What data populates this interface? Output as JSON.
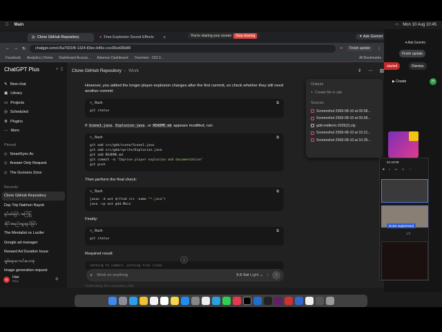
{
  "menubar": {
    "app": "Main",
    "time": "Mon 10 Aug 10:45"
  },
  "share": {
    "text": "You're sharing your screen",
    "stop": "Stop sharing"
  },
  "browser": {
    "tabs": [
      {
        "label": "Clone GitHub Repository"
      },
      {
        "label": "Free Explosion Sound Effects"
      }
    ],
    "ask_gemini": "Ask Gemini",
    "url": "chatgpt.com/c/6a7931f8-1324-83ec-b46c-cce36ed36b89",
    "finish_update": "Finish update",
    "bookmarks": [
      "Facebook",
      "Analytics | Home",
      "Dashboard Access...",
      "Adsense Dashboard",
      "Overview - 233-3..."
    ],
    "all_bookmarks": "All Bookmarks"
  },
  "sidebar": {
    "title": "ChatGPT Plus",
    "items": [
      "New chat",
      "Library",
      "Projects",
      "Scheduled",
      "Plugins",
      "More"
    ],
    "pinned_header": "Pinned",
    "pinned": [
      "SmartSync Ac",
      "Answer Only Request",
      "The Gunners Zone"
    ],
    "recents_header": "Recents",
    "recents": [
      "Clone GitHub Repository",
      "Day Trip Nakhon Nayok",
      "ရုပ်ဖမ်းခြင်း အကြံပြု",
      "ဆိုင်အမည်ရွေးချယ်ခြင်း",
      "The Mentalist vs Lucifer",
      "Google ad manager",
      "Reward Ad Duration Issue",
      "ချစ်စရာကောင်းသောစုံ",
      "Image generation request"
    ],
    "user_initials": "H",
    "user_name": "Hax",
    "user_plan": "Plus"
  },
  "header": {
    "crumb1": "Clone GitHub Repository",
    "crumb2": "Work"
  },
  "chat": {
    "p1": "However, you added the longer player-explosion changes after the first commit, so check whether they still need another commit:",
    "bash": "Bash",
    "code1": "git status",
    "p2_a": "If",
    "p2_c1": "Scene1.java",
    "p2_c2": "Explosion.java",
    "p2_c3": "README.md",
    "p2_b": "appears modified, run:",
    "code2_l1": "git add src/gdd/scene/Scene1.java",
    "code2_l2": "git add src/gdd/sprite/Explosion.java",
    "code2_l3": "git add README.md",
    "code2_l4a": "git commit -m ",
    "code2_l4b": "\"Improve player explosion and documentation\"",
    "code2_l5": "git push",
    "p3": "Then perform the final check:",
    "code3_l1a": "javac -d out $(find src -name ",
    "code3_l1b": "\"*.java\"",
    "code3_l1c": ")",
    "code3_l2": "java -cp out gdd.Main",
    "p4": "Finally:",
    "code4": "git status",
    "p5": "Required result:",
    "code5": "nothing to commit, working tree clean",
    "faded": "Submitting the repository link"
  },
  "composer": {
    "placeholder": "Work on anything",
    "model": "5.6 Sol",
    "mode": "Light"
  },
  "panel": {
    "outputs": "Outputs",
    "create": "Create file or site",
    "sources": "Sources",
    "files": [
      "Screenshot 2569-08-10 at 09.58...",
      "Screenshot 2569-08-10 at 09.58...",
      "gdd-midterm-2026(2).zip",
      "Screenshot 2569-08-10 at 10.21...",
      "Screenshot 2569-08-10 at 10.39..."
    ]
  },
  "right_app": {
    "ask": "Ask Gemini",
    "finish": "Finish update",
    "started": "started",
    "dismiss": "Dismiss",
    "create": "Create"
  },
  "meet": {
    "timer": "01:43:08",
    "noise": "Noise suppressed",
    "page": "1/3"
  }
}
